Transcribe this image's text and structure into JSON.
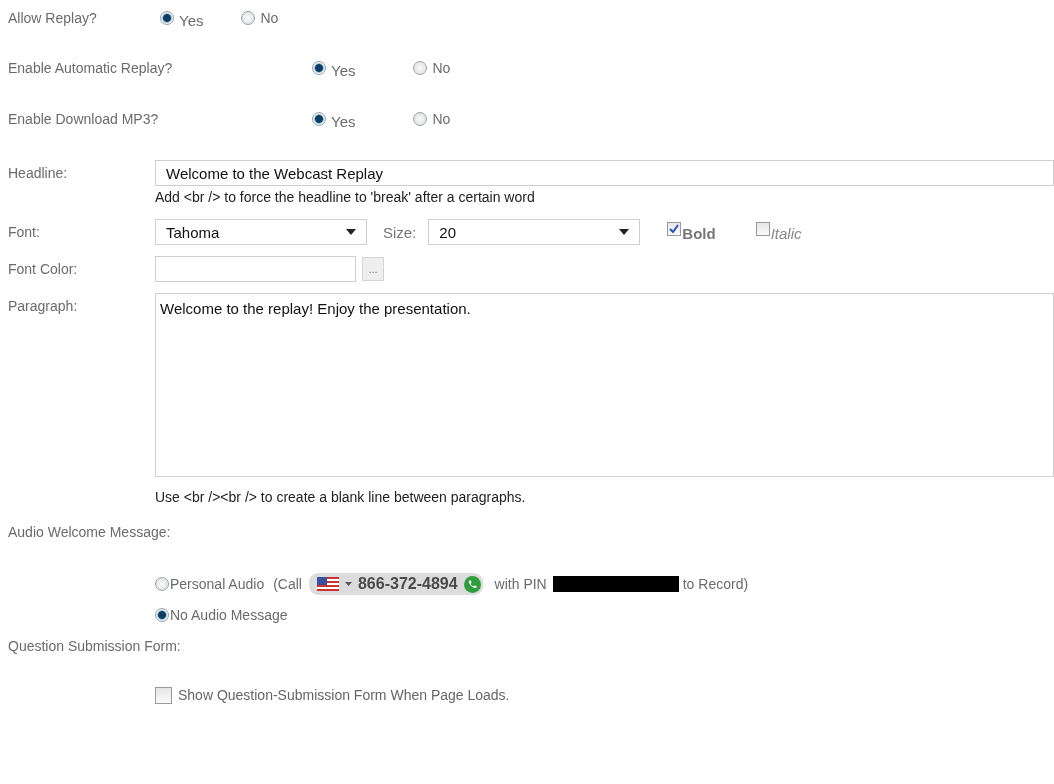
{
  "replay_options": [
    {
      "label": "Allow Replay?",
      "options": [
        {
          "label": "Yes",
          "selected": true
        },
        {
          "label": "No",
          "selected": false
        }
      ]
    },
    {
      "label": "Enable Automatic Replay?",
      "options": [
        {
          "label": "Yes",
          "selected": true
        },
        {
          "label": "No",
          "selected": false
        }
      ]
    },
    {
      "label": "Enable Download MP3?",
      "options": [
        {
          "label": "Yes",
          "selected": true
        },
        {
          "label": "No",
          "selected": false
        }
      ]
    }
  ],
  "headline": {
    "label": "Headline:",
    "value": "Welcome to the Webcast Replay",
    "hint": "Add <br /> to force the headline to 'break' after a certain word"
  },
  "font": {
    "label": "Font:",
    "value": "Tahoma",
    "size_label": "Size:",
    "size_value": "20",
    "bold": {
      "label": "Bold",
      "checked": true
    },
    "italic": {
      "label": "Italic",
      "checked": false
    }
  },
  "font_color": {
    "label": "Font Color:",
    "button": "..."
  },
  "paragraph": {
    "label": "Paragraph:",
    "value": "Welcome to the replay! Enjoy the presentation.",
    "hint": "Use <br /><br /> to create a blank line between paragraphs."
  },
  "audio_welcome": {
    "label": "Audio Welcome Message:",
    "options": [
      {
        "kind": "call",
        "label": "Personal Audio",
        "call_prefix": "(Call",
        "phone": "866-372-4894",
        "pin_text": "with PIN",
        "suffix": "to Record)",
        "selected": false
      },
      {
        "kind": "plain",
        "label": "No Audio Message",
        "selected": true
      }
    ]
  },
  "question_form": {
    "label": "Question Submission Form:",
    "option": {
      "label": "Show Question-Submission Form When Page Loads.",
      "checked": false
    }
  }
}
